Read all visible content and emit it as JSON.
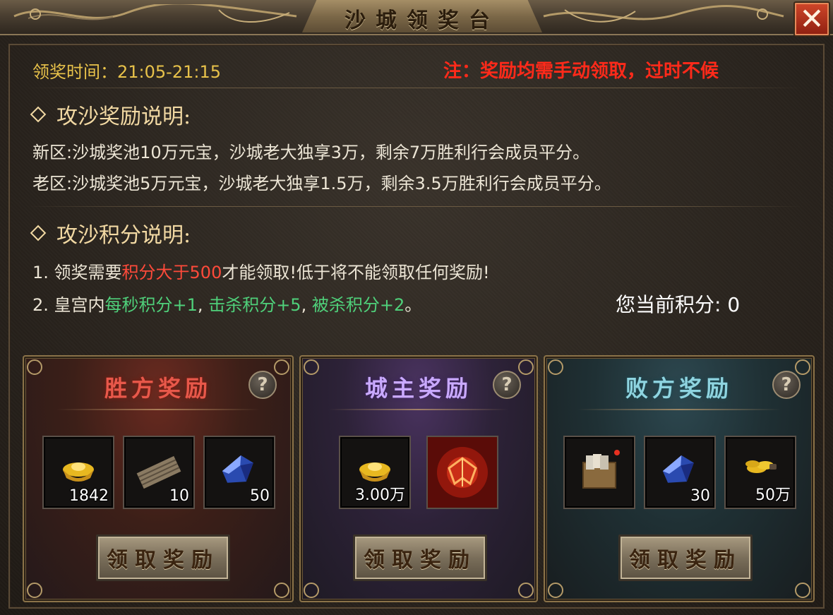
{
  "window": {
    "title": "沙城领奖台",
    "close_label": "✕"
  },
  "header": {
    "time_label": "领奖时间：21:05-21:15",
    "notice": "注：奖励均需手动领取，过时不候"
  },
  "reward_section": {
    "title": "攻沙奖励说明:",
    "lines": [
      "新区:沙城奖池10万元宝，沙城老大独享3万，剩余7万胜利行会成员平分。",
      "老区:沙城奖池5万元宝，沙城老大独享1.5万，剩余3.5万胜利行会成员平分。"
    ]
  },
  "score_section": {
    "title": "攻沙积分说明:",
    "rule1": {
      "prefix": "1. 领奖需要",
      "highlight": "积分大于500",
      "suffix": "才能领取!低于将不能领取任何奖励!"
    },
    "rule2": {
      "prefix": "2. 皇宫内",
      "part1": "每秒积分+1",
      "sep1": ",",
      "part2": "击杀积分+5",
      "sep2": ",",
      "part3": "被杀积分+2",
      "end": "。"
    },
    "current_score_label": "您当前积分:",
    "current_score": "0"
  },
  "cards": {
    "winner": {
      "title": "胜方奖励",
      "help": "?",
      "items": [
        {
          "icon": "gold-ingot-icon",
          "qty": "1842"
        },
        {
          "icon": "scroll-bundle-icon",
          "qty": "10"
        },
        {
          "icon": "blue-crystal-icon",
          "qty": "50"
        }
      ],
      "claim_label": "领取奖励"
    },
    "lord": {
      "title": "城主奖励",
      "help": "?",
      "items": [
        {
          "icon": "gold-ingot-icon",
          "qty": "3.00万"
        },
        {
          "icon": "flame-emblem-icon",
          "qty": ""
        }
      ],
      "claim_label": "领取奖励"
    },
    "loser": {
      "title": "败方奖励",
      "help": "?",
      "items": [
        {
          "icon": "card-pack-icon",
          "qty": ""
        },
        {
          "icon": "blue-crystal-icon",
          "qty": "30"
        },
        {
          "icon": "gold-coins-icon",
          "qty": "50万"
        }
      ],
      "claim_label": "领取奖励"
    }
  },
  "colors": {
    "accent_gold": "#e8c24a",
    "notice_red": "#ff2a1a",
    "highlight_green": "#4fd07a"
  }
}
